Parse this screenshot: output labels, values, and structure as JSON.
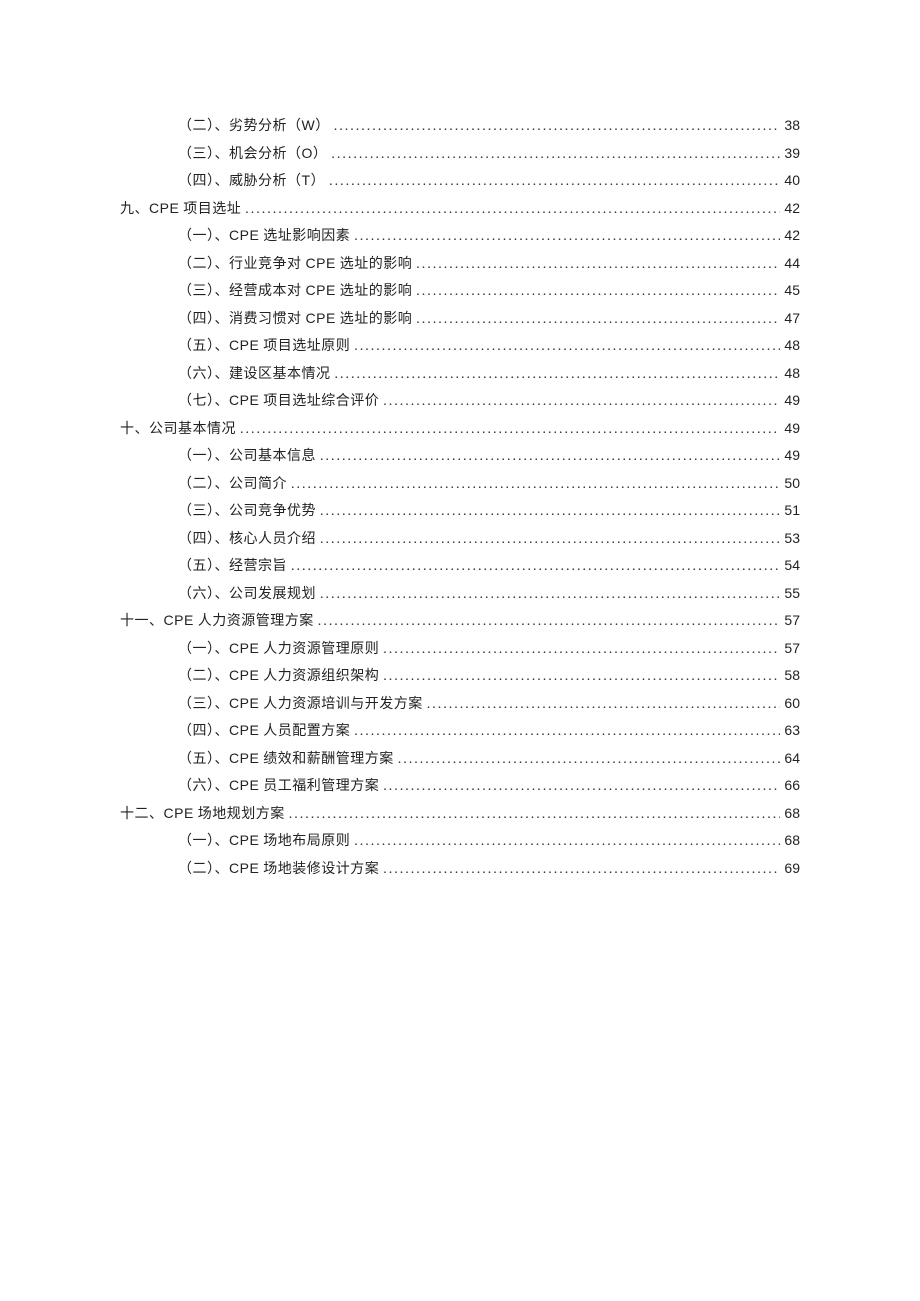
{
  "toc": [
    {
      "level": 2,
      "prefix": "（二）、",
      "title": "劣势分析（W）",
      "page": "38"
    },
    {
      "level": 2,
      "prefix": "（三）、",
      "title": "机会分析（O）",
      "page": "39"
    },
    {
      "level": 2,
      "prefix": "（四）、",
      "title": "威胁分析（T）",
      "page": "40"
    },
    {
      "level": 1,
      "prefix": "九、",
      "title": "CPE 项目选址",
      "page": "42"
    },
    {
      "level": 2,
      "prefix": "（一）、",
      "title": "CPE 选址影响因素",
      "page": "42"
    },
    {
      "level": 2,
      "prefix": "（二）、",
      "title": "行业竞争对 CPE 选址的影响",
      "page": "44"
    },
    {
      "level": 2,
      "prefix": "（三）、",
      "title": "经营成本对 CPE 选址的影响",
      "page": "45"
    },
    {
      "level": 2,
      "prefix": "（四）、",
      "title": "消费习惯对 CPE 选址的影响",
      "page": "47"
    },
    {
      "level": 2,
      "prefix": "（五）、",
      "title": "CPE 项目选址原则",
      "page": "48"
    },
    {
      "level": 2,
      "prefix": "（六）、",
      "title": "建设区基本情况",
      "page": "48"
    },
    {
      "level": 2,
      "prefix": "（七）、",
      "title": "CPE 项目选址综合评价",
      "page": "49"
    },
    {
      "level": 1,
      "prefix": "十、",
      "title": "公司基本情况",
      "page": "49"
    },
    {
      "level": 2,
      "prefix": "（一）、",
      "title": "公司基本信息",
      "page": "49"
    },
    {
      "level": 2,
      "prefix": "（二）、",
      "title": "公司简介",
      "page": "50"
    },
    {
      "level": 2,
      "prefix": "（三）、",
      "title": "公司竞争优势",
      "page": "51"
    },
    {
      "level": 2,
      "prefix": "（四）、",
      "title": "核心人员介绍",
      "page": "53"
    },
    {
      "level": 2,
      "prefix": "（五）、",
      "title": "经营宗旨",
      "page": "54"
    },
    {
      "level": 2,
      "prefix": "（六）、",
      "title": "公司发展规划",
      "page": "55"
    },
    {
      "level": 1,
      "prefix": "十一、",
      "title": "CPE 人力资源管理方案",
      "page": "57"
    },
    {
      "level": 2,
      "prefix": "（一）、",
      "title": "CPE 人力资源管理原则",
      "page": "57"
    },
    {
      "level": 2,
      "prefix": "（二）、",
      "title": "CPE 人力资源组织架构",
      "page": "58"
    },
    {
      "level": 2,
      "prefix": "（三）、",
      "title": "CPE 人力资源培训与开发方案",
      "page": "60"
    },
    {
      "level": 2,
      "prefix": "（四）、",
      "title": "CPE 人员配置方案",
      "page": "63"
    },
    {
      "level": 2,
      "prefix": "（五）、",
      "title": "CPE 绩效和薪酬管理方案",
      "page": "64"
    },
    {
      "level": 2,
      "prefix": "（六）、",
      "title": "CPE 员工福利管理方案",
      "page": "66"
    },
    {
      "level": 1,
      "prefix": "十二、",
      "title": "CPE 场地规划方案",
      "page": "68"
    },
    {
      "level": 2,
      "prefix": "（一）、",
      "title": "CPE 场地布局原则",
      "page": "68"
    },
    {
      "level": 2,
      "prefix": "（二）、",
      "title": "CPE 场地装修设计方案",
      "page": "69"
    }
  ]
}
